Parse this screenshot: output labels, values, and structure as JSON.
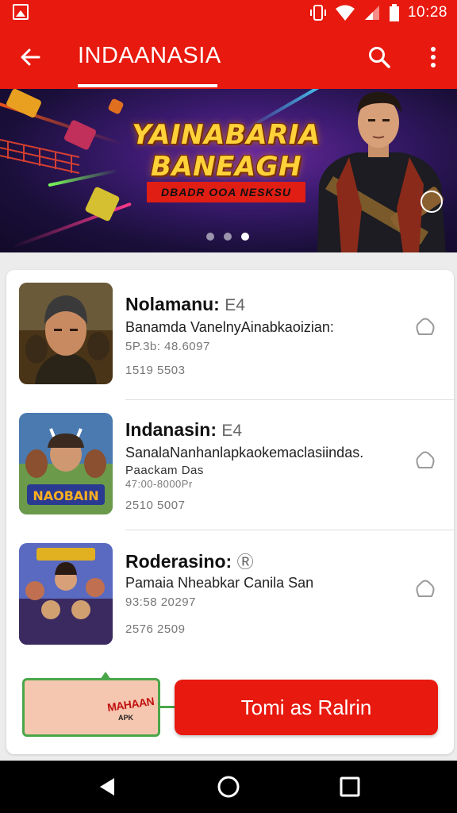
{
  "status_bar": {
    "time": "10:28"
  },
  "app_bar": {
    "title": "INDAANASIA"
  },
  "banner": {
    "title_line1": "YAINABARIA",
    "title_line2": "BANEAGH",
    "subtitle": "DBADR OOA NESKSU",
    "page_count": 3,
    "active_page": 3
  },
  "apps": [
    {
      "name": "Nolamanu:",
      "tag": "E4",
      "description": "Banamda VanelnyAinabkaoizian:",
      "meta1": "5P.3b: 48.6097",
      "meta2": "1519  5503"
    },
    {
      "name": "Indanasin:",
      "tag": "E4",
      "description": "SanalaNanhanlapkaokemaclasiindas.",
      "meta1": "Paackam Das",
      "meta1b": "47:00-8000Pr",
      "meta2": "2510  5007"
    },
    {
      "name": "Roderasino:",
      "tag": "Ⓡ",
      "description": "Pamaia Nheabkar Canila San",
      "meta1": "93:58  20297",
      "meta2": "2576  2509"
    }
  ],
  "promo": {
    "logo_text": "MAHAAN",
    "logo_sub": "APK"
  },
  "action_button": {
    "label": "Tomi as Ralrin"
  },
  "colors": {
    "primary": "#e8190f",
    "accent": "#ffd23a",
    "promo_border": "#4aa64a"
  }
}
